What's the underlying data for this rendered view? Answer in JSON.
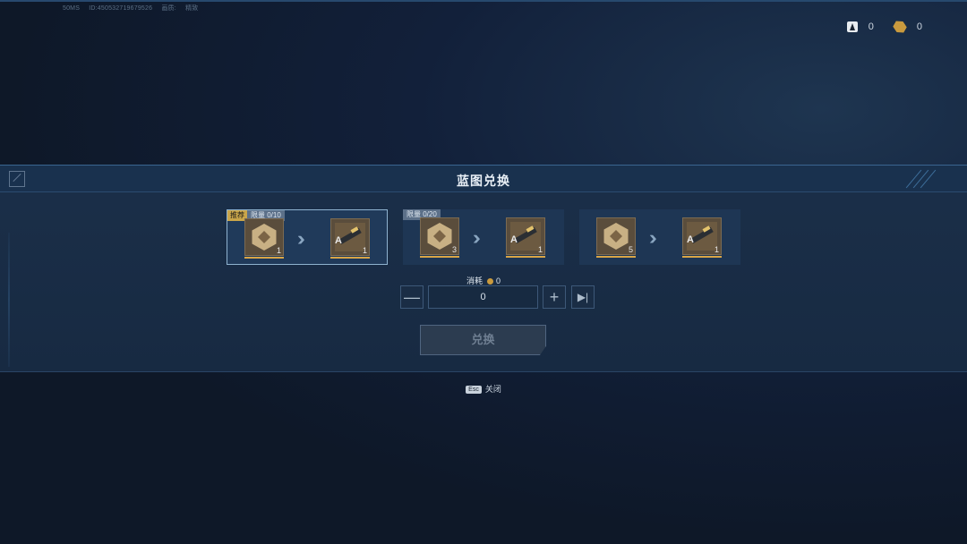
{
  "debug": {
    "ping": "50MS",
    "id": "ID:450532719679526",
    "info1": "画质:",
    "info2": "精致"
  },
  "currency": [
    {
      "icon": "a-token-icon",
      "value": "0"
    },
    {
      "icon": "gold-hex-coin-icon",
      "value": "0"
    }
  ],
  "panel": {
    "title": "蓝图兑换"
  },
  "cards": [
    {
      "recommend_tag": "推荐",
      "limit_label": "限量 0/10",
      "input_qty": "1",
      "output_letter": "A",
      "output_qty": "1",
      "selected": true
    },
    {
      "recommend_tag": "",
      "limit_label": "限量 0/20",
      "input_qty": "3",
      "output_letter": "A",
      "output_qty": "1",
      "selected": false
    },
    {
      "recommend_tag": "",
      "limit_label": "",
      "input_qty": "5",
      "output_letter": "A",
      "output_qty": "1",
      "selected": false
    }
  ],
  "cost": {
    "label": "消耗",
    "value": "0"
  },
  "quantity": {
    "value": "0"
  },
  "buttons": {
    "minus": "—",
    "plus": "+",
    "max": "▶|",
    "exchange": "兑换"
  },
  "close": {
    "key": "Esc",
    "label": "关闭"
  },
  "colors": {
    "accent_gold": "#c9a54a",
    "panel_bg": "#1b2f49",
    "selected_border": "#8fb3d0"
  }
}
